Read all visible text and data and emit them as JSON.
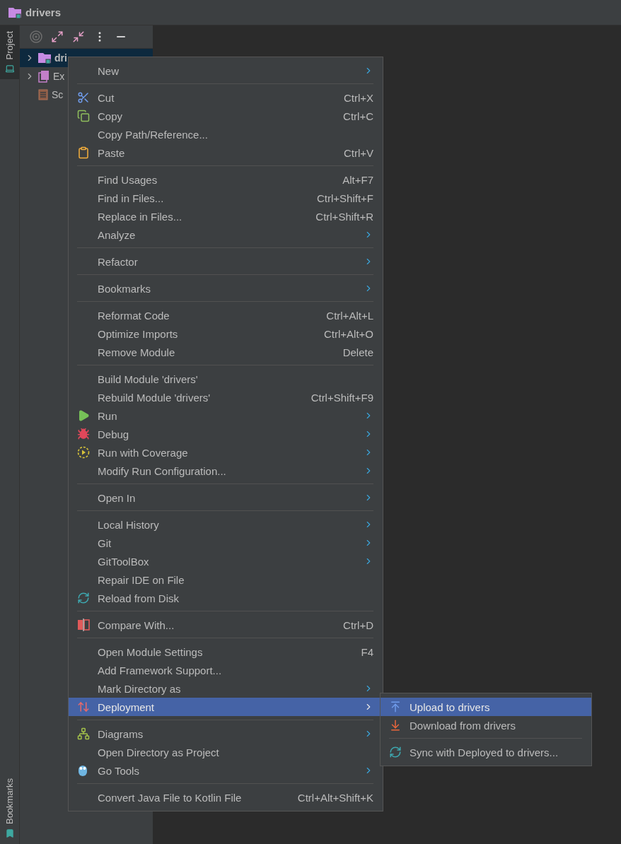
{
  "window": {
    "title": "drivers"
  },
  "side_tabs": [
    {
      "label": "Project",
      "selected": true
    },
    {
      "label": "Bookmarks",
      "selected": false
    }
  ],
  "tree": [
    {
      "label": "dri",
      "expanded": false,
      "selected": true
    },
    {
      "label": "Ex",
      "expanded": false,
      "selected": false
    },
    {
      "label": "Sc",
      "selected": false
    }
  ],
  "context_menu": {
    "groups": [
      [
        {
          "label": "New",
          "submenu": true,
          "selected": false
        }
      ],
      [
        {
          "label": "Cut",
          "shortcut": "Ctrl+X",
          "selected": false
        },
        {
          "label": "Copy",
          "shortcut": "Ctrl+C",
          "selected": false
        },
        {
          "label": "Copy Path/Reference...",
          "selected": false
        },
        {
          "label": "Paste",
          "shortcut": "Ctrl+V",
          "selected": false
        }
      ],
      [
        {
          "label": "Find Usages",
          "shortcut": "Alt+F7",
          "selected": false
        },
        {
          "label": "Find in Files...",
          "shortcut": "Ctrl+Shift+F",
          "selected": false
        },
        {
          "label": "Replace in Files...",
          "shortcut": "Ctrl+Shift+R",
          "selected": false
        },
        {
          "label": "Analyze",
          "submenu": true,
          "selected": false
        }
      ],
      [
        {
          "label": "Refactor",
          "submenu": true,
          "selected": false
        }
      ],
      [
        {
          "label": "Bookmarks",
          "submenu": true,
          "selected": false
        }
      ],
      [
        {
          "label": "Reformat Code",
          "shortcut": "Ctrl+Alt+L",
          "selected": false
        },
        {
          "label": "Optimize Imports",
          "shortcut": "Ctrl+Alt+O",
          "selected": false
        },
        {
          "label": "Remove Module",
          "shortcut": "Delete",
          "selected": false
        }
      ],
      [
        {
          "label": "Build Module 'drivers'",
          "selected": false
        },
        {
          "label": "Rebuild Module 'drivers'",
          "shortcut": "Ctrl+Shift+F9",
          "selected": false
        },
        {
          "label": "Run",
          "submenu": true,
          "selected": false
        },
        {
          "label": "Debug",
          "submenu": true,
          "selected": false
        },
        {
          "label": "Run with Coverage",
          "submenu": true,
          "selected": false
        },
        {
          "label": "Modify Run Configuration...",
          "submenu": true,
          "selected": false
        }
      ],
      [
        {
          "label": "Open In",
          "submenu": true,
          "selected": false
        }
      ],
      [
        {
          "label": "Local History",
          "submenu": true,
          "selected": false
        },
        {
          "label": "Git",
          "submenu": true,
          "selected": false
        },
        {
          "label": "GitToolBox",
          "submenu": true,
          "selected": false
        },
        {
          "label": "Repair IDE on File",
          "selected": false
        },
        {
          "label": "Reload from Disk",
          "selected": false
        }
      ],
      [
        {
          "label": "Compare With...",
          "shortcut": "Ctrl+D",
          "selected": false
        }
      ],
      [
        {
          "label": "Open Module Settings",
          "shortcut": "F4",
          "selected": false
        },
        {
          "label": "Add Framework Support...",
          "selected": false
        },
        {
          "label": "Mark Directory as",
          "submenu": true,
          "selected": false
        },
        {
          "label": "Deployment",
          "submenu": true,
          "selected": true
        }
      ],
      [
        {
          "label": "Diagrams",
          "submenu": true,
          "selected": false
        },
        {
          "label": "Open Directory as Project",
          "selected": false
        },
        {
          "label": "Go Tools",
          "submenu": true,
          "selected": false
        }
      ],
      [
        {
          "label": "Convert Java File to Kotlin File",
          "shortcut": "Ctrl+Alt+Shift+K",
          "selected": false
        }
      ]
    ]
  },
  "submenu": {
    "groups": [
      [
        {
          "label": "Upload to drivers",
          "selected": true
        },
        {
          "label": "Download from drivers",
          "selected": false
        }
      ],
      [
        {
          "label": "Sync with Deployed to drivers...",
          "selected": false
        }
      ]
    ]
  }
}
